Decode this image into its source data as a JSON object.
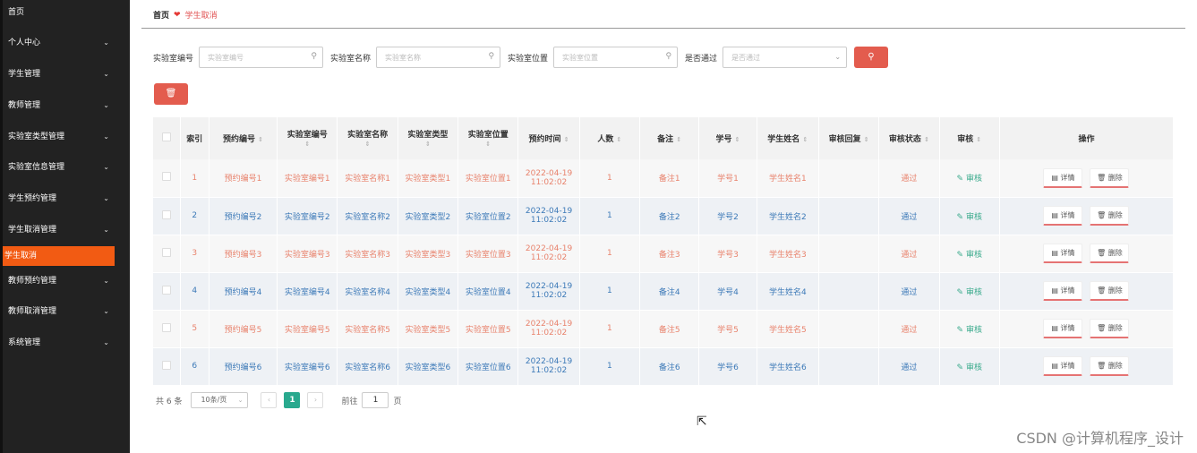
{
  "sidebar": {
    "items": [
      {
        "label": "首页",
        "has_arrow": false
      },
      {
        "label": "个人中心",
        "has_arrow": true
      },
      {
        "label": "学生管理",
        "has_arrow": true
      },
      {
        "label": "教师管理",
        "has_arrow": true
      },
      {
        "label": "实验室类型管理",
        "has_arrow": true
      },
      {
        "label": "实验室信息管理",
        "has_arrow": true
      },
      {
        "label": "学生预约管理",
        "has_arrow": true
      },
      {
        "label": "学生取消管理",
        "has_arrow": true
      },
      {
        "label": "学生取消",
        "has_arrow": false,
        "active": true
      },
      {
        "label": "教师预约管理",
        "has_arrow": true
      },
      {
        "label": "教师取消管理",
        "has_arrow": true
      },
      {
        "label": "系统管理",
        "has_arrow": true
      }
    ]
  },
  "breadcrumb": {
    "home": "首页",
    "current": "学生取消"
  },
  "search": {
    "lab_no_label": "实验室编号",
    "lab_no_placeholder": "实验室编号",
    "lab_name_label": "实验室名称",
    "lab_name_placeholder": "实验室名称",
    "lab_loc_label": "实验室位置",
    "lab_loc_placeholder": "实验室位置",
    "passed_label": "是否通过",
    "passed_placeholder": "是否通过"
  },
  "table": {
    "headers": [
      "索引",
      "预约编号",
      "实验室编号",
      "实验室名称",
      "实验室类型",
      "实验室位置",
      "预约时间",
      "人数",
      "备注",
      "学号",
      "学生姓名",
      "审核回复",
      "审核状态",
      "审核",
      "操作"
    ],
    "rows": [
      {
        "idx": "1",
        "booking_no": "预约编号1",
        "lab_no": "实验室编号1",
        "lab_name": "实验室名称1",
        "lab_type": "实验室类型1",
        "lab_loc": "实验室位置1",
        "date": "2022-04-19",
        "time": "11:02:02",
        "count": "1",
        "note": "备注1",
        "student_no": "学号1",
        "student_name": "学生姓名1",
        "reply": "",
        "status": "通过",
        "review": "审核",
        "detail": "详情",
        "delete": "删除"
      },
      {
        "idx": "2",
        "booking_no": "预约编号2",
        "lab_no": "实验室编号2",
        "lab_name": "实验室名称2",
        "lab_type": "实验室类型2",
        "lab_loc": "实验室位置2",
        "date": "2022-04-19",
        "time": "11:02:02",
        "count": "1",
        "note": "备注2",
        "student_no": "学号2",
        "student_name": "学生姓名2",
        "reply": "",
        "status": "通过",
        "review": "审核",
        "detail": "详情",
        "delete": "删除"
      },
      {
        "idx": "3",
        "booking_no": "预约编号3",
        "lab_no": "实验室编号3",
        "lab_name": "实验室名称3",
        "lab_type": "实验室类型3",
        "lab_loc": "实验室位置3",
        "date": "2022-04-19",
        "time": "11:02:02",
        "count": "1",
        "note": "备注3",
        "student_no": "学号3",
        "student_name": "学生姓名3",
        "reply": "",
        "status": "通过",
        "review": "审核",
        "detail": "详情",
        "delete": "删除"
      },
      {
        "idx": "4",
        "booking_no": "预约编号4",
        "lab_no": "实验室编号4",
        "lab_name": "实验室名称4",
        "lab_type": "实验室类型4",
        "lab_loc": "实验室位置4",
        "date": "2022-04-19",
        "time": "11:02:02",
        "count": "1",
        "note": "备注4",
        "student_no": "学号4",
        "student_name": "学生姓名4",
        "reply": "",
        "status": "通过",
        "review": "审核",
        "detail": "详情",
        "delete": "删除"
      },
      {
        "idx": "5",
        "booking_no": "预约编号5",
        "lab_no": "实验室编号5",
        "lab_name": "实验室名称5",
        "lab_type": "实验室类型5",
        "lab_loc": "实验室位置5",
        "date": "2022-04-19",
        "time": "11:02:02",
        "count": "1",
        "note": "备注5",
        "student_no": "学号5",
        "student_name": "学生姓名5",
        "reply": "",
        "status": "通过",
        "review": "审核",
        "detail": "详情",
        "delete": "删除"
      },
      {
        "idx": "6",
        "booking_no": "预约编号6",
        "lab_no": "实验室编号6",
        "lab_name": "实验室名称6",
        "lab_type": "实验室类型6",
        "lab_loc": "实验室位置6",
        "date": "2022-04-19",
        "time": "11:02:02",
        "count": "1",
        "note": "备注6",
        "student_no": "学号6",
        "student_name": "学生姓名6",
        "reply": "",
        "status": "通过",
        "review": "审核",
        "detail": "详情",
        "delete": "删除"
      }
    ]
  },
  "pager": {
    "total": "共 6 条",
    "page_size": "10条/页",
    "current": "1",
    "goto_prefix": "前往",
    "goto_value": "1",
    "goto_suffix": "页"
  },
  "watermark": "CSDN @计算机程序_设计",
  "colors": {
    "accent_active": "#f25b13",
    "button": "#e35c4e",
    "pager_current": "#29a98e",
    "odd_text": "#e8836d",
    "even_text": "#3d7ab8"
  }
}
